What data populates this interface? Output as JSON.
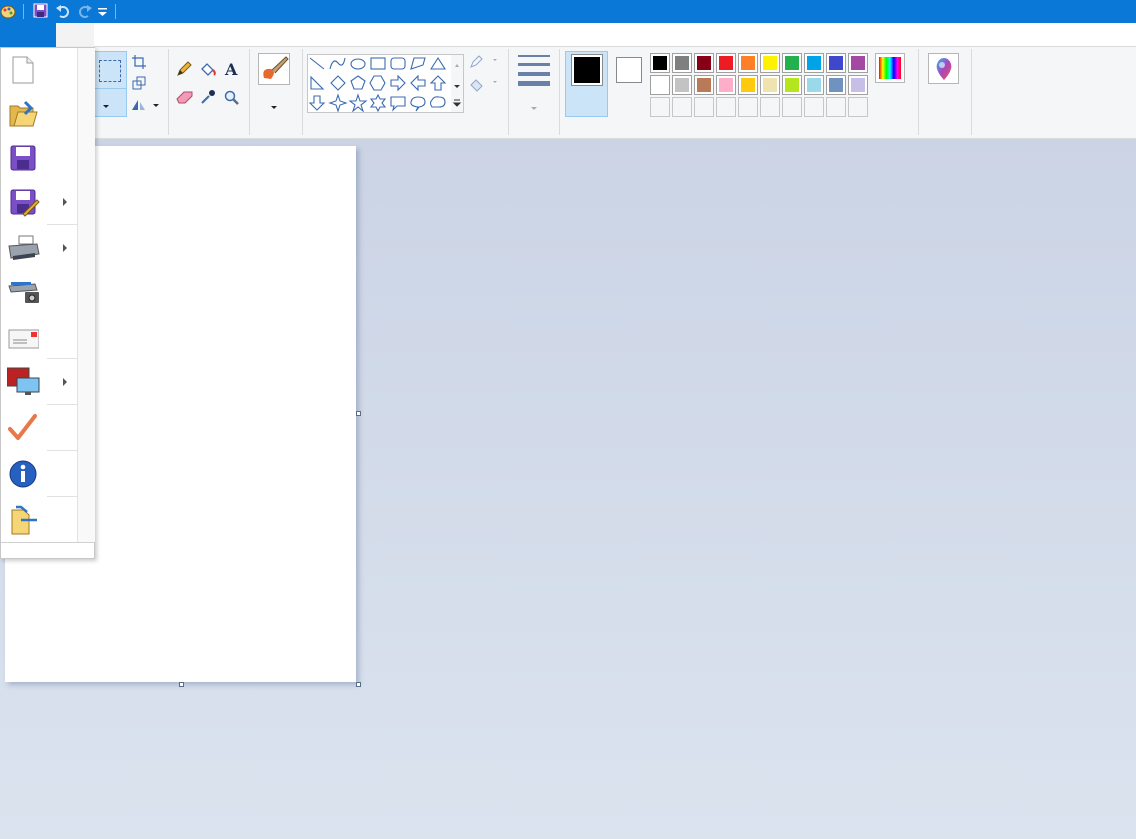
{
  "app": {
    "quick_access": [
      "paint-app-icon",
      "save-icon",
      "undo-icon",
      "redo-icon",
      "customize-dropdown-icon"
    ]
  },
  "file_menu": {
    "items": [
      {
        "name": "new",
        "icon": "new-document-icon",
        "has_submenu": false
      },
      {
        "name": "open",
        "icon": "open-folder-icon",
        "has_submenu": false
      },
      {
        "name": "save",
        "icon": "save-icon",
        "has_submenu": false
      },
      {
        "name": "save-as",
        "icon": "save-as-icon",
        "has_submenu": true
      },
      {
        "name": "print",
        "icon": "printer-icon",
        "has_submenu": true
      },
      {
        "name": "from-scanner-or-camera",
        "icon": "scanner-camera-icon",
        "has_submenu": false
      },
      {
        "name": "send-in-email",
        "icon": "email-icon",
        "has_submenu": false
      },
      {
        "name": "set-as-desktop-background",
        "icon": "desktop-background-icon",
        "has_submenu": true
      },
      {
        "name": "properties",
        "icon": "checkmark-icon",
        "has_submenu": false
      },
      {
        "name": "about-paint",
        "icon": "info-icon",
        "has_submenu": false
      },
      {
        "name": "exit",
        "icon": "exit-icon",
        "has_submenu": false
      }
    ]
  },
  "ribbon": {
    "tools": [
      "pencil-icon",
      "fill-bucket-icon",
      "text-icon",
      "eraser-icon",
      "color-picker-icon",
      "magnifier-icon"
    ],
    "shapes": [
      "line",
      "curve",
      "oval",
      "rectangle",
      "rounded-rectangle",
      "polygon",
      "triangle",
      "right-triangle",
      "diamond",
      "pentagon",
      "hexagon",
      "right-arrow",
      "left-arrow",
      "up-arrow",
      "down-arrow",
      "four-point-star",
      "five-point-star",
      "six-point-star",
      "rounded-callout",
      "oval-callout",
      "cloud-callout"
    ],
    "color1": "#000000",
    "color2": "#ffffff"
  },
  "palette": [
    [
      "#000000",
      "#7f7f7f",
      "#880015",
      "#ed1c24",
      "#ff7f27",
      "#fff200",
      "#22b14c",
      "#00a2e8",
      "#3f48cc",
      "#a349a4"
    ],
    [
      "#ffffff",
      "#c3c3c3",
      "#b97a57",
      "#ffaec9",
      "#ffc90e",
      "#efe4b0",
      "#b5e61d",
      "#99d9ea",
      "#7092be",
      "#c8bfe7"
    ],
    [
      "",
      "",
      "",
      "",
      "",
      "",
      "",
      "",
      "",
      ""
    ]
  ],
  "colors": {
    "accent": "#0a78d7",
    "workspace": "#c8d1e3",
    "ribbon_bg": "#f5f6f7"
  }
}
